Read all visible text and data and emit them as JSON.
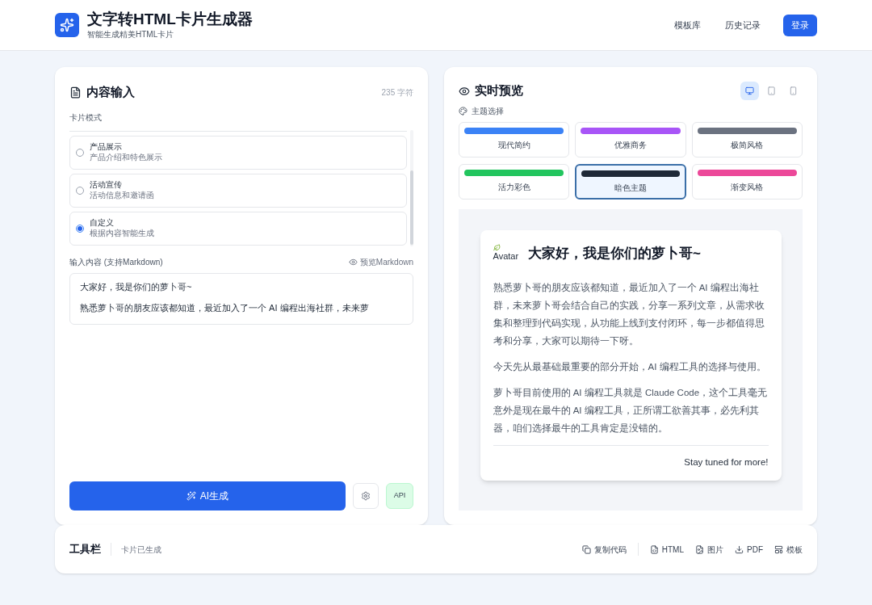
{
  "header": {
    "title": "文字转HTML卡片生成器",
    "subtitle": "智能生成精美HTML卡片",
    "nav": [
      "模板库",
      "历史记录"
    ],
    "login": "登录"
  },
  "input_panel": {
    "title": "内容输入",
    "char_count": "235 字符",
    "mode_label": "卡片模式",
    "modes": [
      {
        "name": "产品展示",
        "desc": "产品介绍和特色展示",
        "selected": false
      },
      {
        "name": "活动宣传",
        "desc": "活动信息和邀请函",
        "selected": false
      },
      {
        "name": "自定义",
        "desc": "根据内容智能生成",
        "selected": true
      }
    ],
    "content_label": "输入内容 (支持Markdown)",
    "preview_markdown": "预览Markdown",
    "content_lines": [
      "大家好，我是你们的萝卜哥~",
      "熟悉萝卜哥的朋友应该都知道，最近加入了一个 AI 编程出海社群，未来萝"
    ],
    "generate": "AI生成",
    "api": "API"
  },
  "preview_panel": {
    "title": "实时预览",
    "devices": [
      {
        "kind": "desktop",
        "selected": true
      },
      {
        "kind": "tablet",
        "selected": false
      },
      {
        "kind": "phone",
        "selected": false
      }
    ],
    "theme_label": "主题选择",
    "themes": [
      {
        "name": "现代简约",
        "color": "#3b82f6",
        "selected": false
      },
      {
        "name": "优雅商务",
        "color": "#a855f7",
        "selected": false
      },
      {
        "name": "极简风格",
        "color": "#6b7280",
        "selected": false
      },
      {
        "name": "活力彩色",
        "color": "#22c55e",
        "selected": false
      },
      {
        "name": "暗色主题",
        "color": "#1f2937",
        "selected": true
      },
      {
        "name": "渐变风格",
        "color": "#ec4899",
        "selected": false
      }
    ],
    "card": {
      "avatar_alt": "Avatar",
      "title": "大家好，我是你们的萝卜哥~",
      "paragraphs": [
        "熟悉萝卜哥的朋友应该都知道，最近加入了一个 AI 编程出海社群，未来萝卜哥会结合自己的实践，分享一系列文章，从需求收集和整理到代码实现，从功能上线到支付闭环，每一步都值得思考和分享，大家可以期待一下呀。",
        "今天先从最基础最重要的部分开始，AI 编程工具的选择与使用。",
        "萝卜哥目前使用的 AI 编程工具就是 Claude Code，这个工具毫无意外是现在最牛的 AI 编程工具，正所谓工欲善其事，必先利其器，咱们选择最牛的工具肯定是没错的。"
      ],
      "footer": "Stay tuned for more!"
    }
  },
  "toolbar": {
    "title": "工具栏",
    "status": "卡片已生成",
    "actions": [
      {
        "kind": "copy",
        "label": "复制代码"
      },
      {
        "kind": "html",
        "label": "HTML"
      },
      {
        "kind": "image",
        "label": "图片"
      },
      {
        "kind": "pdf",
        "label": "PDF"
      },
      {
        "kind": "template",
        "label": "模板"
      }
    ]
  }
}
